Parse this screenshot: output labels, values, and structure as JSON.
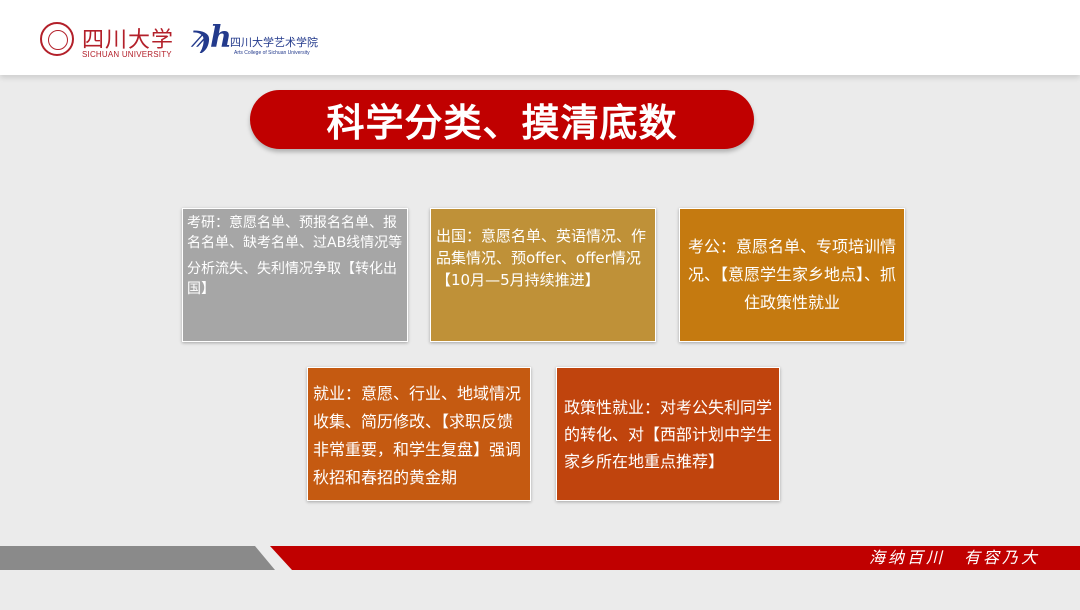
{
  "header": {
    "logo_scu_cn": "四川大学",
    "logo_scu_en": "SICHUAN UNIVERSITY",
    "logo_arts_cn": "四川大学艺术学院",
    "logo_arts_en": "Arts College of Sichuan University"
  },
  "title": "科学分类、摸清底数",
  "boxes": {
    "kaoyan": {
      "line1": "考研：意愿名单、预报名名单、报名名单、缺考名单、过AB线情况等",
      "line2": "分析流失、失利情况争取【转化出国】",
      "color": "#a6a6a6"
    },
    "chuguo": {
      "line1": "出国：意愿名单、英语情况、作品集情况、预offer、offer情况",
      "line2": "【10月—5月持续推进】",
      "color": "#bf9138"
    },
    "kaogong": {
      "text": "考公：意愿名单、专项培训情况、【意愿学生家乡地点】、抓住政策性就业",
      "color": "#c57a10"
    },
    "jiuye": {
      "text": "就业：意愿、行业、地域情况收集、简历修改、【求职反馈非常重要，和学生复盘】强调秋招和春招的黄金期",
      "color": "#c55a11"
    },
    "zhengce": {
      "text": "政策性就业：对考公失利同学的转化、对【西部计划中学生家乡所在地重点推荐】",
      "color": "#c0440d"
    }
  },
  "footer": {
    "motto": "海纳百川　有容乃大"
  },
  "colors": {
    "brand_red": "#c00000",
    "footer_gray": "#8a8a8a"
  }
}
